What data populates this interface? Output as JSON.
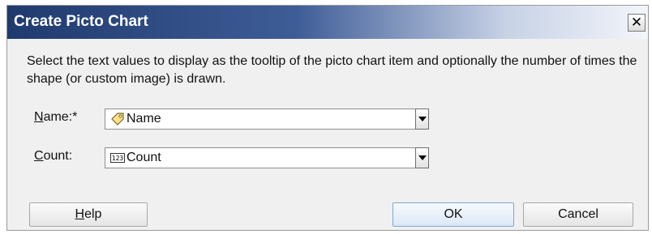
{
  "dialog": {
    "title": "Create Picto Chart",
    "close_label": "✕",
    "instructions": "Select the text values to display as the tooltip of the picto chart item and optionally the number of times the shape (or custom image) is drawn."
  },
  "fields": {
    "name": {
      "label_mnemonic": "N",
      "label_rest": "ame:*",
      "value": "Name",
      "icon": "tag-icon"
    },
    "count": {
      "label_mnemonic": "C",
      "label_rest": "ount:",
      "value": "Count",
      "icon": "numeric-123-icon"
    }
  },
  "buttons": {
    "help_mnemonic": "H",
    "help_rest": "elp",
    "ok": "OK",
    "cancel": "Cancel"
  }
}
